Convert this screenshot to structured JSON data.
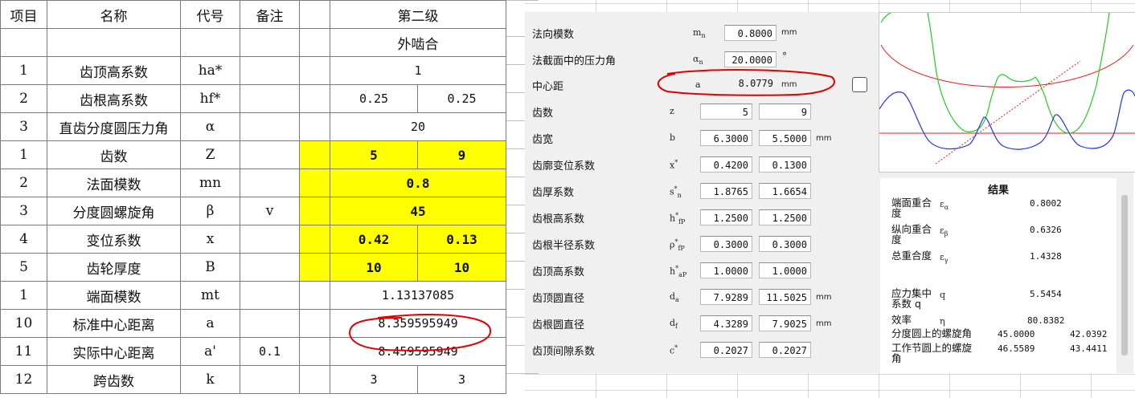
{
  "sheet": {
    "headers": {
      "col1": "项目",
      "col2": "名称",
      "col3": "代号",
      "col4": "备注",
      "col6": "第二级"
    },
    "subheader": "外啮合",
    "rows": [
      {
        "item": "1",
        "name": "齿顶高系数",
        "code": "ha*",
        "note": "",
        "merged": "1"
      },
      {
        "item": "2",
        "name": "齿根高系数",
        "code": "hf*",
        "note": "",
        "v1": "0.25",
        "v2": "0.25"
      },
      {
        "item": "3",
        "name": "直齿分度圆压力角",
        "code": "α",
        "note": "",
        "merged": "20"
      },
      {
        "item": "1",
        "name": "齿数",
        "code": "Z",
        "note": "",
        "v1": "5",
        "v2": "9"
      },
      {
        "item": "2",
        "name": "法面模数",
        "code": "mn",
        "note": "",
        "merged": "0.8"
      },
      {
        "item": "3",
        "name": "分度圆螺旋角",
        "code": "β",
        "note": "v",
        "merged": "45"
      },
      {
        "item": "4",
        "name": "变位系数",
        "code": "x",
        "note": "",
        "v1": "0.42",
        "v2": "0.13"
      },
      {
        "item": "5",
        "name": "齿轮厚度",
        "code": "B",
        "note": "",
        "v1": "10",
        "v2": "10"
      },
      {
        "item": "1",
        "name": "端面模数",
        "code": "mt",
        "note": "",
        "merged": "1.13137085"
      },
      {
        "item": "10",
        "name": "标准中心距离",
        "code": "a",
        "note": "",
        "merged": "8.359595949"
      },
      {
        "item": "11",
        "name": "实际中心距离",
        "code": "a'",
        "note": "0.1",
        "merged": "8.459595949"
      },
      {
        "item": "12",
        "name": "跨齿数",
        "code": "k",
        "note": "",
        "v1": "3",
        "v2": "3"
      }
    ]
  },
  "dialog": {
    "module": {
      "label": "法向模数",
      "symbol": "m",
      "sub": "n",
      "value": "0.8000",
      "unit": "mm"
    },
    "pressure_angle": {
      "label": "法截面中的压力角",
      "symbol": "α",
      "sub": "n",
      "value": "20.0000",
      "unit": "°"
    },
    "center_distance": {
      "label": "中心距",
      "symbol": "a",
      "value": "8.0779",
      "unit": "mm"
    },
    "teeth": {
      "label": "齿数",
      "symbol": "z",
      "v1": "5",
      "v2": "9"
    },
    "width": {
      "label": "齿宽",
      "symbol": "b",
      "v1": "6.3000",
      "v2": "5.5000",
      "unit": "mm"
    },
    "profile_shift": {
      "label": "齿廓变位系数",
      "symbol": "x",
      "sup": "*",
      "v1": "0.4200",
      "v2": "0.1300"
    },
    "thickness_coef": {
      "label": "齿厚系数",
      "symbol": "s",
      "sup": "*",
      "sub": "n",
      "v1": "1.8765",
      "v2": "1.6654"
    },
    "dedendum_coef": {
      "label": "齿根高系数",
      "symbol": "h",
      "sup": "*",
      "sub": "fP",
      "v1": "1.2500",
      "v2": "1.2500"
    },
    "root_radius_coef": {
      "label": "齿根半径系数",
      "symbol": "ρ",
      "sup": "*",
      "sub": "fP",
      "v1": "0.3000",
      "v2": "0.3000"
    },
    "addendum_coef": {
      "label": "齿顶高系数",
      "symbol": "h",
      "sup": "*",
      "sub": "aP",
      "v1": "1.0000",
      "v2": "1.0000"
    },
    "tip_diameter": {
      "label": "齿顶圆直径",
      "symbol": "d",
      "sub": "a",
      "v1": "7.9289",
      "v2": "11.5025",
      "unit": "mm"
    },
    "root_diameter": {
      "label": "齿根圆直径",
      "symbol": "d",
      "sub": "f",
      "v1": "4.3289",
      "v2": "7.9025",
      "unit": "mm"
    },
    "tip_clearance": {
      "label": "齿顶间隙系数",
      "symbol": "c",
      "sup": "*",
      "v1": "0.2027",
      "v2": "0.2027"
    }
  },
  "results": {
    "title": "结果",
    "rows": [
      {
        "label": "端面重合度",
        "symbol": "ε",
        "sub": "α",
        "v1": "0.8002"
      },
      {
        "label": "纵向重合度",
        "symbol": "ε",
        "sub": "β",
        "v1": "0.6326"
      },
      {
        "label": "总重合度",
        "symbol": "ε",
        "sub": "γ",
        "v1": "1.4328"
      },
      {
        "label": "应力集中系数 q",
        "symbol": "q",
        "v1": "5.5454"
      },
      {
        "label": "效率",
        "symbol": "η",
        "v1": "80.8382"
      },
      {
        "label": "分度圆上的螺旋角",
        "v1": "45.0000",
        "v2": "42.0392"
      },
      {
        "label": "工作节圆上的螺旋角",
        "v1": "46.5589",
        "v2": "43.4411"
      }
    ]
  },
  "colors": {
    "highlight": "#ffff00",
    "annotation": "#e00000",
    "gear1": "#00cc00",
    "gear2": "#2020ff",
    "circle": "#ee2222"
  }
}
